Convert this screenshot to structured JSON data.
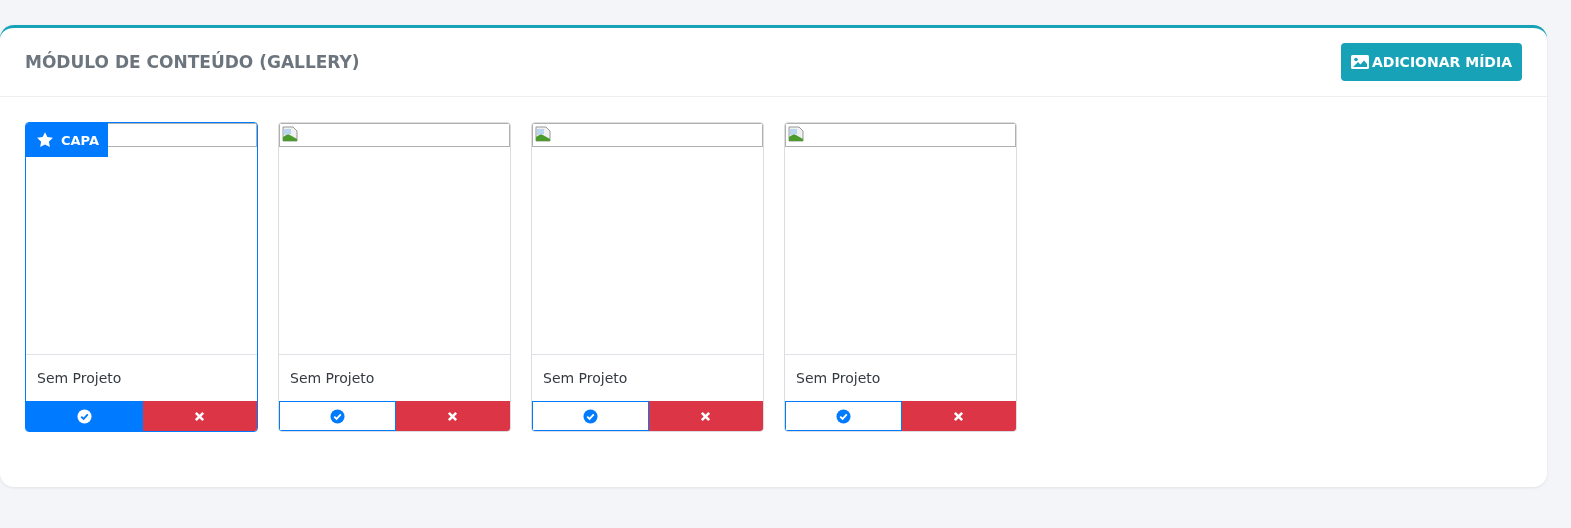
{
  "panel": {
    "title": "MÓDULO DE CONTEÚDO (GALLERY)",
    "add_button": "ADICIONAR MÍDIA"
  },
  "media": [
    {
      "is_cover": true,
      "badge": "CAPA",
      "caption": "Sem Projeto"
    },
    {
      "is_cover": false,
      "caption": "Sem Projeto"
    },
    {
      "is_cover": false,
      "caption": "Sem Projeto"
    },
    {
      "is_cover": false,
      "caption": "Sem Projeto"
    }
  ]
}
